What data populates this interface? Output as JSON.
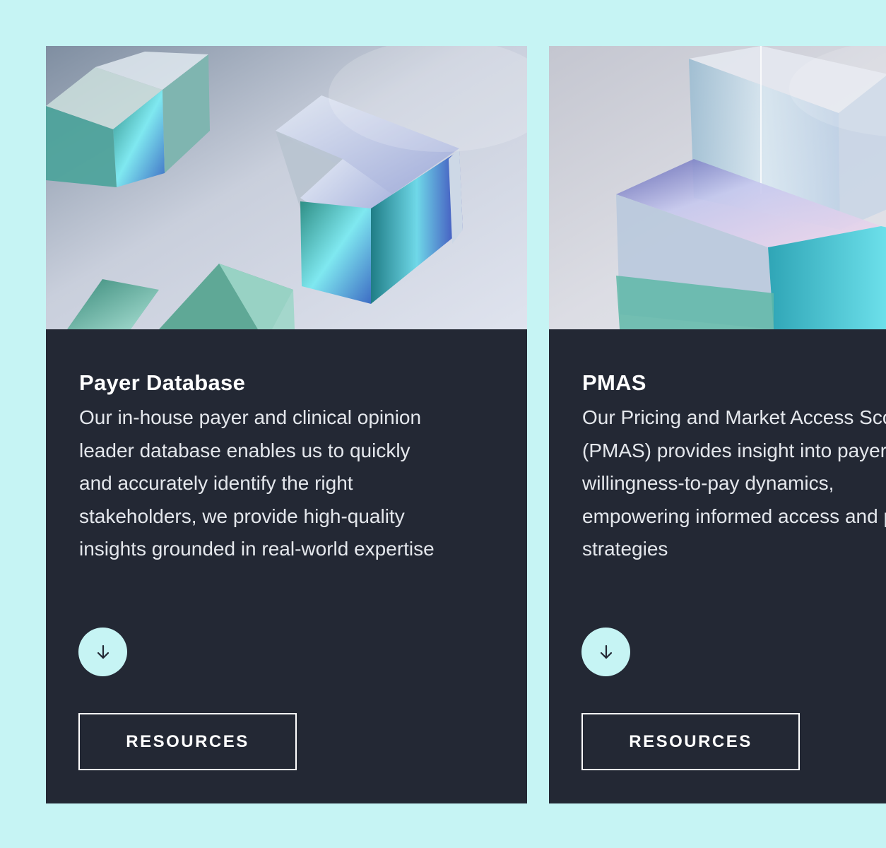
{
  "cards": [
    {
      "title": "Payer Database",
      "description": "Our in-house payer and clinical opinion\nleader database enables us to quickly\nand accurately identify the right\nstakeholders, we provide high-quality\ninsights grounded in real-world expertise",
      "expand_icon": "arrow-down-icon",
      "button_label": "RESOURCES"
    },
    {
      "title": "PMAS",
      "description": "Our Pricing and Market Access Scorecard\n(PMAS) provides insight into payer\nwillingness-to-pay dynamics,\nempowering informed access and pricing\nstrategies",
      "expand_icon": "arrow-down-icon",
      "button_label": "RESOURCES"
    }
  ],
  "colors": {
    "page_background": "#c6f4f4",
    "card_background": "#232834",
    "accent": "#c6f4f4",
    "text": "#ffffff"
  }
}
